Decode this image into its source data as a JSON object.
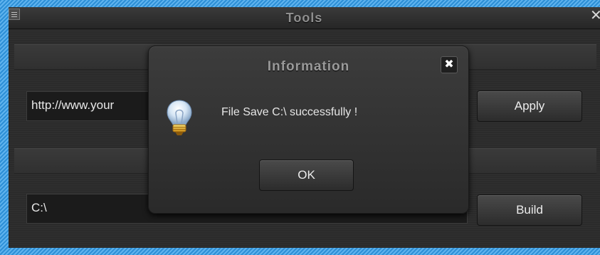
{
  "window": {
    "title": "Tools"
  },
  "url_field": {
    "value": "http://www.your"
  },
  "apply_button": {
    "label": "Apply"
  },
  "path_field": {
    "value": "C:\\"
  },
  "build_button": {
    "label": "Build"
  },
  "dialog": {
    "title": "Information",
    "close_glyph": "✖",
    "message": "File Save C:\\ successfully !",
    "ok_label": "OK",
    "icon": "lightbulb-icon"
  },
  "colors": {
    "frame_border": "#2d8fd6",
    "window_bg": "#2b2b2b",
    "dialog_bg": "#333333",
    "text": "#e6e6e6"
  }
}
